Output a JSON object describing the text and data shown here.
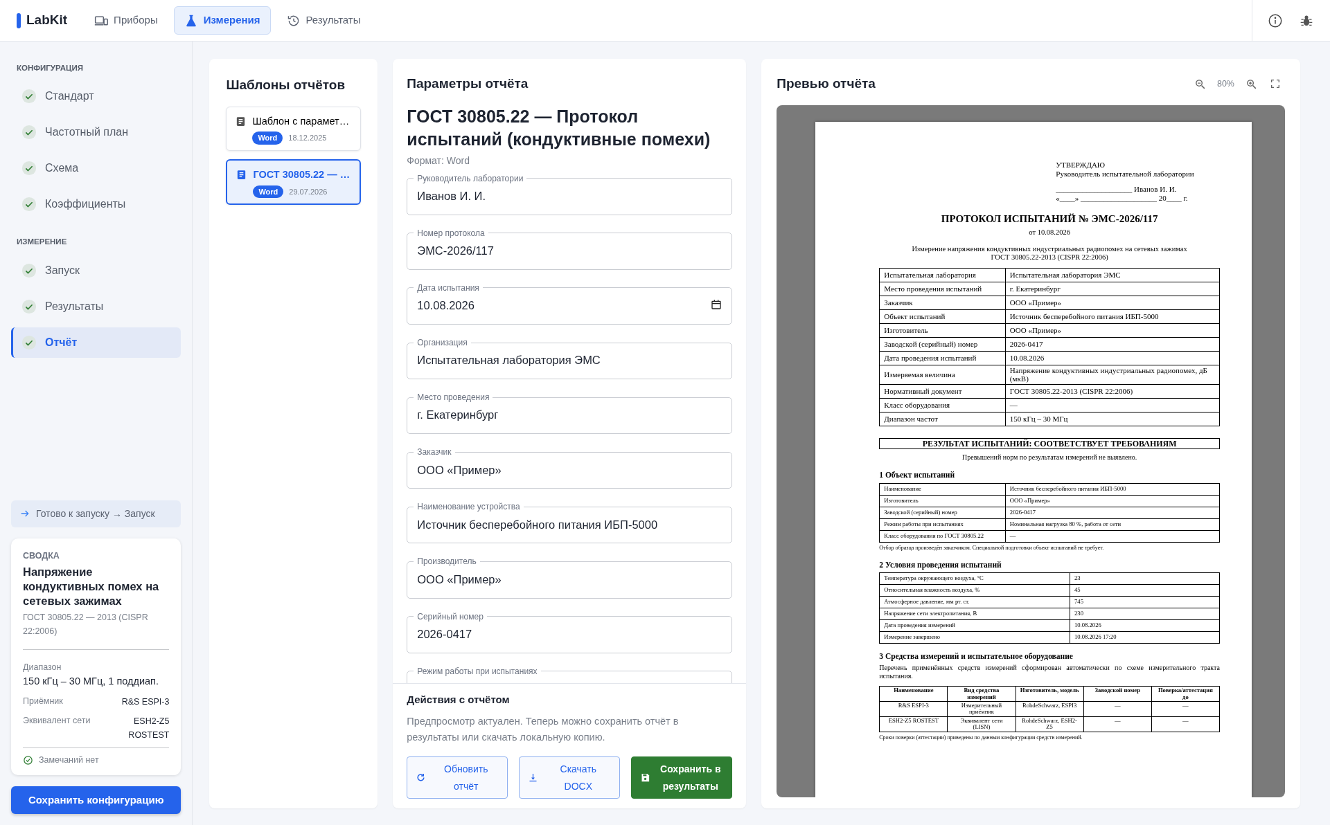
{
  "app": {
    "name": "LabKit"
  },
  "nav_tabs": [
    {
      "label": "Приборы",
      "selected": false
    },
    {
      "label": "Измерения",
      "selected": true
    },
    {
      "label": "Результаты",
      "selected": false
    }
  ],
  "sidebar": {
    "sections": [
      {
        "title": "КОНФИГУРАЦИЯ",
        "items": [
          {
            "label": "Стандарт",
            "done": true,
            "selected": false
          },
          {
            "label": "Частотный план",
            "done": true,
            "selected": false
          },
          {
            "label": "Схема",
            "done": true,
            "selected": false
          },
          {
            "label": "Коэффициенты",
            "done": true,
            "selected": false
          }
        ]
      },
      {
        "title": "ИЗМЕРЕНИЕ",
        "items": [
          {
            "label": "Запуск",
            "done": true,
            "selected": false
          },
          {
            "label": "Результаты",
            "done": true,
            "selected": false
          },
          {
            "label": "Отчёт",
            "done": true,
            "selected": true
          }
        ]
      }
    ],
    "hint": "Готово к запуску → Запуск",
    "summary": {
      "label": "СВОДКА",
      "title": "Напряжение кондуктивных помех на сетевых зажимах",
      "standard": "ГОСТ 30805.22 — 2013 (CISPR 22:2006)",
      "range_label": "Диапазон",
      "range": "150 кГц – 30 МГц, 1 поддиап.",
      "rows": [
        {
          "key": "Приёмник",
          "value": "R&S ESPI-3"
        },
        {
          "key": "Эквивалент сети",
          "value": "ESH2-Z5 ROSTEST"
        }
      ],
      "status": "Замечаний нет"
    },
    "save_button": "Сохранить конфигурацию"
  },
  "templates": {
    "title": "Шаблоны отчётов",
    "items": [
      {
        "name": "Шаблон с парамет…",
        "format": "Word",
        "date": "18.12.2025",
        "selected": false
      },
      {
        "name": "ГОСТ 30805.22 — …",
        "format": "Word",
        "date": "29.07.2026",
        "selected": true
      }
    ]
  },
  "params": {
    "title": "Параметры отчёта",
    "heading": "ГОСТ 30805.22 — Протокол испытаний (кондуктивные помехи)",
    "format_line": "Формат: Word",
    "fields": [
      {
        "label": "Руководитель лаборатории",
        "value": "Иванов И. И.",
        "kind": "text"
      },
      {
        "label": "Номер протокола",
        "value": "ЭМС-2026/117",
        "kind": "text"
      },
      {
        "label": "Дата испытания",
        "value": "10.08.2026",
        "kind": "date"
      },
      {
        "label": "Организация",
        "value": "Испытательная лаборатория ЭМС",
        "kind": "text"
      },
      {
        "label": "Место проведения",
        "value": "г. Екатеринбург",
        "kind": "text"
      },
      {
        "label": "Заказчик",
        "value": "ООО «Пример»",
        "kind": "text"
      },
      {
        "label": "Наименование устройства",
        "value": "Источник бесперебойного питания ИБП-5000",
        "kind": "text"
      },
      {
        "label": "Производитель",
        "value": "ООО «Пример»",
        "kind": "text"
      },
      {
        "label": "Серийный номер",
        "value": "2026-0417",
        "kind": "text"
      },
      {
        "label": "Режим работы при испытаниях",
        "kind": "text"
      }
    ],
    "actions": {
      "title": "Действия с отчётом",
      "text": "Предпросмотр актуален. Теперь можно сохранить отчёт в результаты или скачать локальную копию.",
      "buttons": [
        {
          "label": "Обновить отчёт",
          "kind": "refresh"
        },
        {
          "label": "Скачать DOCX",
          "kind": "download"
        },
        {
          "label": "Сохранить в результаты",
          "kind": "save"
        }
      ]
    }
  },
  "preview": {
    "title": "Превью отчёта",
    "zoom": "80%",
    "document": {
      "approval": [
        "УТВЕРЖДАЮ",
        "Руководитель испытательной лаборатории",
        "____________________ Иванов И. И.",
        "«____» ____________________ 20____ г."
      ],
      "title": "ПРОТОКОЛ ИСПЫТАНИЙ № ЭМС-2026/117",
      "date_line": "от 10.08.2026",
      "subject": [
        "Измерение напряжения кондуктивных индустриальных радиопомех на сетевых зажимах",
        "ГОСТ 30805.22-2013 (CISPR 22:2006)"
      ],
      "info_rows": [
        [
          "Испытательная лаборатория",
          "Испытательная лаборатория ЭМС"
        ],
        [
          "Место проведения испытаний",
          "г. Екатеринбург"
        ],
        [
          "Заказчик",
          "ООО «Пример»"
        ],
        [
          "Объект испытаний",
          "Источник бесперебойного питания ИБП-5000"
        ],
        [
          "Изготовитель",
          "ООО «Пример»"
        ],
        [
          "Заводской (серийный) номер",
          "2026-0417"
        ],
        [
          "Дата проведения испытаний",
          "10.08.2026"
        ],
        [
          "Измеряемая величина",
          "Напряжение кондуктивных индустриальных радиопомех, дБ (мкВ)"
        ],
        [
          "Нормативный документ",
          "ГОСТ 30805.22-2013 (CISPR 22:2006)"
        ],
        [
          "Класс оборудования",
          "—"
        ],
        [
          "Диапазон частот",
          "150 кГц – 30 МГц"
        ]
      ],
      "verdict": "РЕЗУЛЬТАТ ИСПЫТАНИЙ: СООТВЕТСТВУЕТ ТРЕБОВАНИЯМ",
      "verdict_note": "Превышений норм по результатам измерений не выявлено.",
      "sections": [
        {
          "heading": "1 Объект испытаний",
          "kind": "pairs",
          "rows": [
            [
              "Наименование",
              "Источник бесперебойного питания ИБП-5000"
            ],
            [
              "Изготовитель",
              "ООО «Пример»"
            ],
            [
              "Заводской (серийный) номер",
              "2026-0417"
            ],
            [
              "Режим работы при испытаниях",
              "Номинальная нагрузка 80 %, работа от сети"
            ],
            [
              "Класс оборудования по ГОСТ 30805.22",
              "—"
            ]
          ],
          "note": "Отбор образца произведён заказчиком. Специальной подготовки объект испытаний не требует."
        },
        {
          "heading": "2 Условия проведения испытаний",
          "kind": "conditions",
          "rows": [
            [
              "Температура окружающего воздуха, °С",
              "23"
            ],
            [
              "Относительная влажность воздуха, %",
              "45"
            ],
            [
              "Атмосферное давление, мм рт. ст.",
              "745"
            ],
            [
              "Напряжение сети электропитания, В",
              "230"
            ],
            [
              "Дата проведения измерений",
              "10.08.2026"
            ],
            [
              "Измерение завершено",
              "10.08.2026 17:20"
            ]
          ]
        },
        {
          "heading": "3 Средства измерений и испытательное оборудование",
          "kind": "grid",
          "intro": "Перечень применённых средств измерений сформирован автоматически по схеме измерительного тракта испытания.",
          "columns": [
            "Наименование",
            "Вид средства измерений",
            "Изготовитель, модель",
            "Заводской номер",
            "Поверка/аттестация до"
          ],
          "rows": [
            [
              "R&S ESPI-3",
              "Измерительный приёмник",
              "RohdeSchwarz, ESPI3",
              "—",
              "—"
            ],
            [
              "ESH2-Z5 ROSTEST",
              "Эквивалент сети (LISN)",
              "RohdeSchwarz, ESH2-Z5",
              "—",
              "—"
            ]
          ],
          "note": "Сроки поверки (аттестации) приведены по данным конфигурации средств измерений."
        }
      ]
    }
  }
}
